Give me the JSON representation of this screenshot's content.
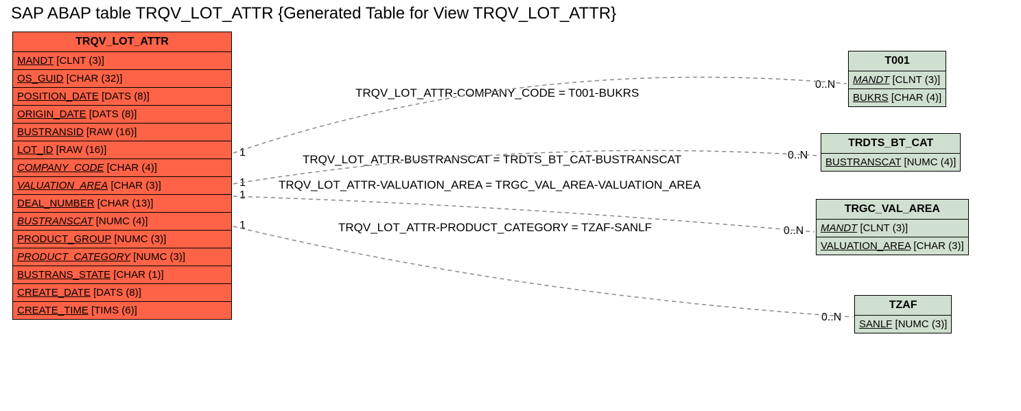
{
  "title": "SAP ABAP table TRQV_LOT_ATTR {Generated Table for View TRQV_LOT_ATTR}",
  "main_table": {
    "name": "TRQV_LOT_ATTR",
    "fields": [
      {
        "name": "MANDT",
        "type": "[CLNT (3)]",
        "underline": true,
        "italic": false
      },
      {
        "name": "OS_GUID",
        "type": "[CHAR (32)]",
        "underline": true,
        "italic": false
      },
      {
        "name": "POSITION_DATE",
        "type": "[DATS (8)]",
        "underline": true,
        "italic": false
      },
      {
        "name": "ORIGIN_DATE",
        "type": "[DATS (8)]",
        "underline": true,
        "italic": false
      },
      {
        "name": "BUSTRANSID",
        "type": "[RAW (16)]",
        "underline": true,
        "italic": false
      },
      {
        "name": "LOT_ID",
        "type": "[RAW (16)]",
        "underline": true,
        "italic": false
      },
      {
        "name": "COMPANY_CODE",
        "type": "[CHAR (4)]",
        "underline": true,
        "italic": true
      },
      {
        "name": "VALUATION_AREA",
        "type": "[CHAR (3)]",
        "underline": true,
        "italic": true
      },
      {
        "name": "DEAL_NUMBER",
        "type": "[CHAR (13)]",
        "underline": true,
        "italic": false
      },
      {
        "name": "BUSTRANSCAT",
        "type": "[NUMC (4)]",
        "underline": true,
        "italic": true
      },
      {
        "name": "PRODUCT_GROUP",
        "type": "[NUMC (3)]",
        "underline": true,
        "italic": false
      },
      {
        "name": "PRODUCT_CATEGORY",
        "type": "[NUMC (3)]",
        "underline": true,
        "italic": true
      },
      {
        "name": "BUSTRANS_STATE",
        "type": "[CHAR (1)]",
        "underline": true,
        "italic": false
      },
      {
        "name": "CREATE_DATE",
        "type": "[DATS (8)]",
        "underline": true,
        "italic": false
      },
      {
        "name": "CREATE_TIME",
        "type": "[TIMS (6)]",
        "underline": true,
        "italic": false
      }
    ]
  },
  "ref_tables": [
    {
      "name": "T001",
      "fields": [
        {
          "name": "MANDT",
          "type": "[CLNT (3)]",
          "underline": true,
          "italic": true
        },
        {
          "name": "BUKRS",
          "type": "[CHAR (4)]",
          "underline": true,
          "italic": false
        }
      ]
    },
    {
      "name": "TRDTS_BT_CAT",
      "fields": [
        {
          "name": "BUSTRANSCAT",
          "type": "[NUMC (4)]",
          "underline": true,
          "italic": false
        }
      ]
    },
    {
      "name": "TRGC_VAL_AREA",
      "fields": [
        {
          "name": "MANDT",
          "type": "[CLNT (3)]",
          "underline": true,
          "italic": true
        },
        {
          "name": "VALUATION_AREA",
          "type": "[CHAR (3)]",
          "underline": true,
          "italic": false
        }
      ]
    },
    {
      "name": "TZAF",
      "fields": [
        {
          "name": "SANLF",
          "type": "[NUMC (3)]",
          "underline": true,
          "italic": false
        }
      ]
    }
  ],
  "relations": [
    {
      "text": "TRQV_LOT_ATTR-COMPANY_CODE = T001-BUKRS",
      "left_card": "1",
      "right_card": "0..N"
    },
    {
      "text": "TRQV_LOT_ATTR-BUSTRANSCAT = TRDTS_BT_CAT-BUSTRANSCAT",
      "left_card": "1",
      "right_card": "0..N"
    },
    {
      "text": "TRQV_LOT_ATTR-VALUATION_AREA = TRGC_VAL_AREA-VALUATION_AREA",
      "left_card": "1",
      "right_card": "0..N"
    },
    {
      "text": "TRQV_LOT_ATTR-PRODUCT_CATEGORY = TZAF-SANLF",
      "left_card": "1",
      "right_card": "0..N"
    }
  ]
}
